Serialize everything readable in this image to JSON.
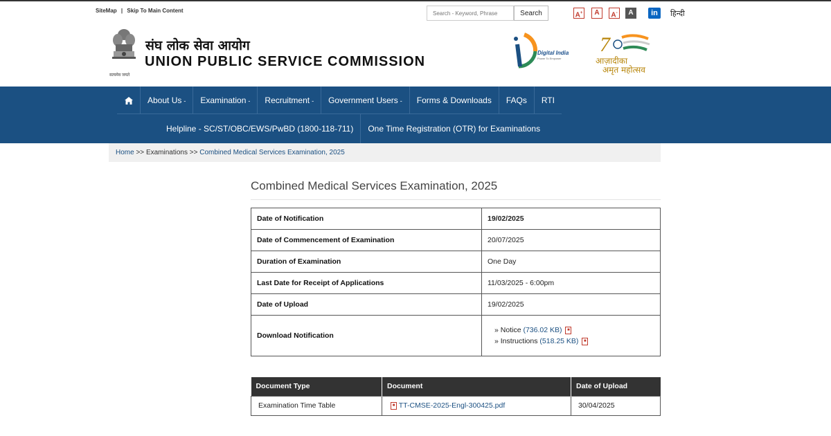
{
  "topbar": {
    "sitemap": "SiteMap",
    "separator": "|",
    "skip": "Skip To Main Content",
    "search_placeholder": "Search - Keyword, Phrase",
    "search_button": "Search",
    "font_large": "A",
    "font_normal": "A",
    "font_small": "A",
    "contrast": "A",
    "linkedin": "in",
    "language": "हिन्दी"
  },
  "header": {
    "title_hindi": "संघ लोक सेवा आयोग",
    "title_english": "UNION PUBLIC SERVICE COMMISSION",
    "emblem_caption": "सत्यमेव जयते",
    "digital_india": "Digital India",
    "digital_india_tagline": "Power To Empower",
    "azadi_line1": "आज़ादीका",
    "azadi_line2": "अमृत महोत्सव"
  },
  "nav": {
    "row1": [
      {
        "label": "About Us",
        "has_caret": true
      },
      {
        "label": "Examination",
        "has_caret": true
      },
      {
        "label": "Recruitment",
        "has_caret": true
      },
      {
        "label": "Government Users",
        "has_caret": true
      },
      {
        "label": "Forms & Downloads",
        "has_caret": false
      },
      {
        "label": "FAQs",
        "has_caret": false
      },
      {
        "label": "RTI",
        "has_caret": false
      }
    ],
    "caret": "-",
    "row2": [
      {
        "label": "Helpline - SC/ST/OBC/EWS/PwBD (1800-118-711)"
      },
      {
        "label": "One Time Registration (OTR) for Examinations"
      }
    ]
  },
  "breadcrumb": {
    "home": "Home",
    "sep1": ">>",
    "section": "Examinations",
    "sep2": ">>",
    "current": "Combined Medical Services Examination, 2025"
  },
  "page": {
    "title": "Combined Medical Services Examination, 2025"
  },
  "info_table": [
    {
      "label": "Date of Notification",
      "value": "19/02/2025"
    },
    {
      "label": "Date of Commencement of Examination",
      "value": "20/07/2025"
    },
    {
      "label": "Duration of Examination",
      "value": "One Day"
    },
    {
      "label": "Last Date for Receipt of Applications",
      "value": "11/03/2025 - 6:00pm"
    },
    {
      "label": "Date of Upload",
      "value": "19/02/2025"
    }
  ],
  "download": {
    "label": "Download Notification",
    "bullet": "»",
    "notice_label": "Notice",
    "notice_size": "(736.02 KB)",
    "instructions_label": "Instructions",
    "instructions_size": "(518.25 KB)"
  },
  "docs_table": {
    "headers": [
      "Document Type",
      "Document",
      "Date of Upload"
    ],
    "rows": [
      {
        "type": "Examination Time Table",
        "document": "TT-CMSE-2025-Engl-300425.pdf",
        "date": "30/04/2025"
      }
    ]
  },
  "colors": {
    "nav_bg": "#1b5082",
    "link": "#1b5082",
    "table_header": "#333333"
  }
}
